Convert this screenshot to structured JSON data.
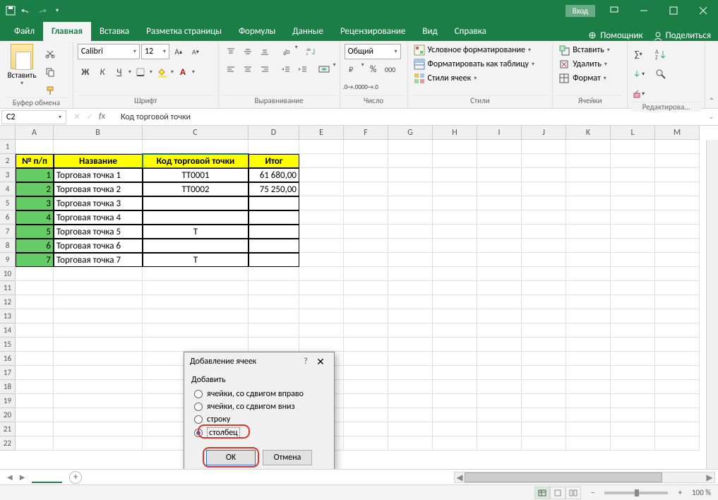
{
  "titlebar": {
    "login": "Вход"
  },
  "tabs": [
    "Файл",
    "Главная",
    "Вставка",
    "Разметка страницы",
    "Формулы",
    "Данные",
    "Рецензирование",
    "Вид",
    "Справка"
  ],
  "active_tab": 1,
  "helper": "Помощник",
  "share": "Поделиться",
  "ribbon": {
    "clipboard": {
      "paste": "Вставить",
      "label": "Буфер обмена"
    },
    "font": {
      "name": "Calibri",
      "size": "12",
      "label": "Шрифт",
      "bold": "Ж",
      "italic": "К",
      "underline": "Ч"
    },
    "align": {
      "label": "Выравнивание"
    },
    "number": {
      "format": "Общий",
      "label": "Число"
    },
    "styles": {
      "cond": "Условное форматирование",
      "table": "Форматировать как таблицу",
      "cell": "Стили ячеек",
      "label": "Стили"
    },
    "cells": {
      "insert": "Вставить",
      "delete": "Удалить",
      "format": "Формат",
      "label": "Ячейки"
    },
    "edit": {
      "label": "Редактирова..."
    }
  },
  "namebox": "C2",
  "formula": "Код торговой точки",
  "columns": [
    {
      "l": "A",
      "w": 54
    },
    {
      "l": "B",
      "w": 126
    },
    {
      "l": "C",
      "w": 150
    },
    {
      "l": "D",
      "w": 72
    },
    {
      "l": "E",
      "w": 63
    },
    {
      "l": "F",
      "w": 63
    },
    {
      "l": "G",
      "w": 63
    },
    {
      "l": "H",
      "w": 63
    },
    {
      "l": "I",
      "w": 63
    },
    {
      "l": "J",
      "w": 63
    },
    {
      "l": "K",
      "w": 63
    },
    {
      "l": "L",
      "w": 63
    },
    {
      "l": "M",
      "w": 63
    }
  ],
  "rows": 22,
  "headers": {
    "a": "№ п/п",
    "b": "Название",
    "c": "Код торговой точки",
    "d": "Итог"
  },
  "data": [
    {
      "n": "1",
      "name": "Торговая точка 1",
      "code": "ТТ0001",
      "total": "61 680,00"
    },
    {
      "n": "2",
      "name": "Торговая точка 2",
      "code": "ТТ0002",
      "total": "75 250,00"
    },
    {
      "n": "3",
      "name": "Торговая точка 3",
      "code": "",
      "total": ""
    },
    {
      "n": "4",
      "name": "Торговая точка 4",
      "code": "",
      "total": ""
    },
    {
      "n": "5",
      "name": "Торговая точка 5",
      "code": "Т",
      "total": ""
    },
    {
      "n": "6",
      "name": "Торговая точка 6",
      "code": "",
      "total": ""
    },
    {
      "n": "7",
      "name": "Торговая точка 7",
      "code": "Т",
      "total": ""
    }
  ],
  "dialog": {
    "title": "Добавление ячеек",
    "group": "Добавить",
    "opts": [
      "ячейки, со сдвигом вправо",
      "ячейки, со сдвигом вниз",
      "строку",
      "столбец"
    ],
    "selected": 3,
    "ok": "OK",
    "cancel": "Отмена"
  },
  "zoom": "100 %"
}
